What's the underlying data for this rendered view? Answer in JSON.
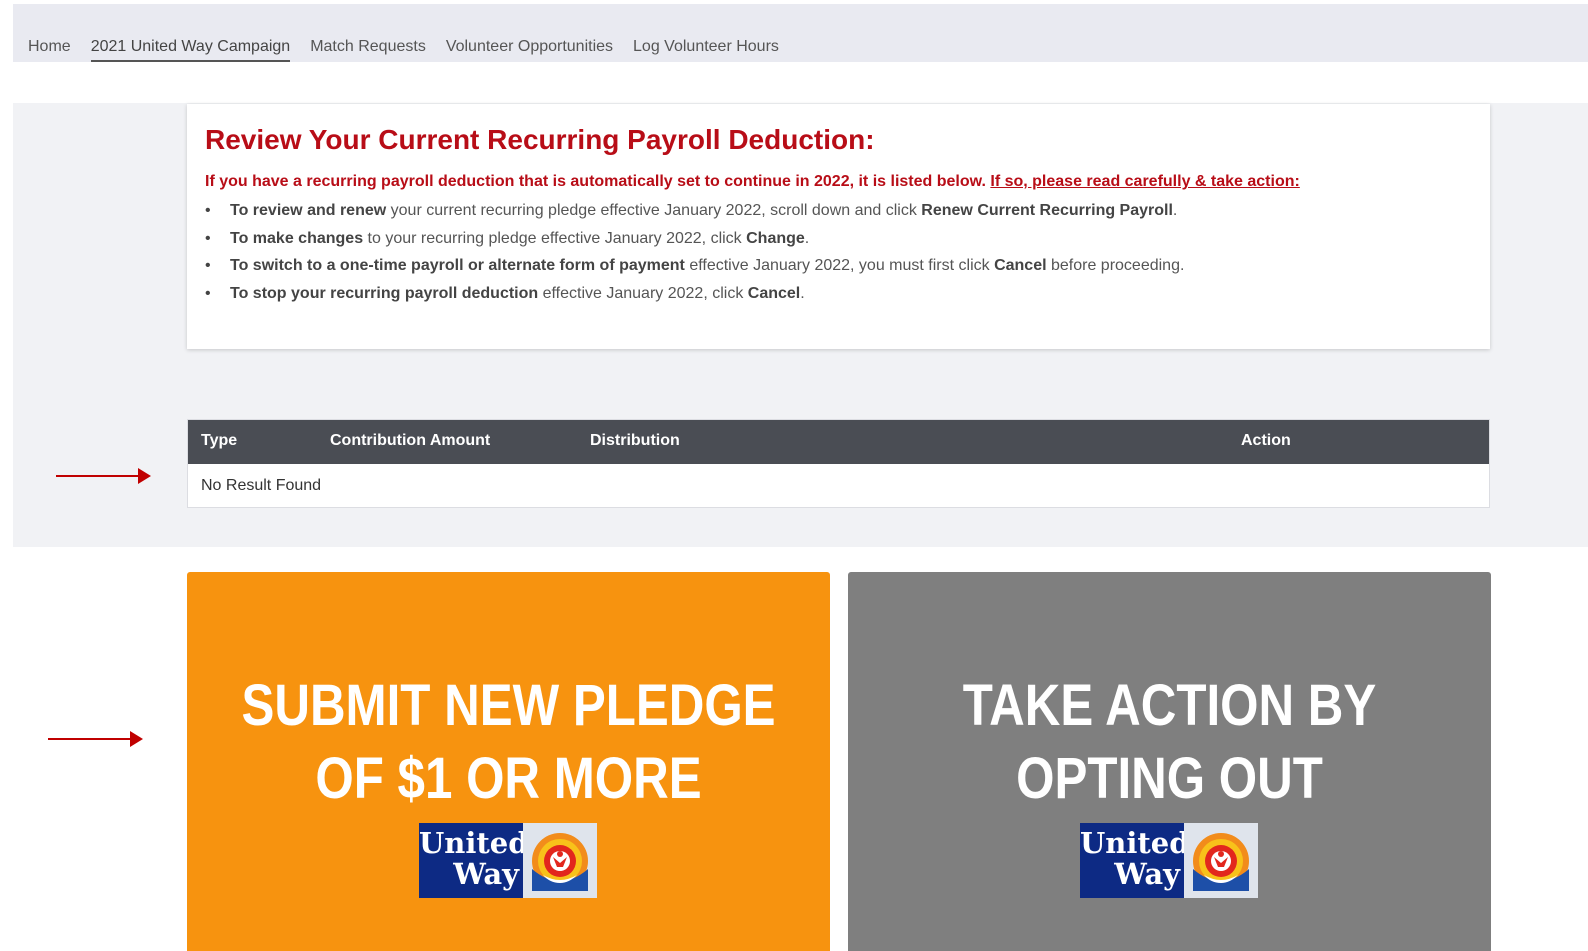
{
  "nav": {
    "items": [
      {
        "label": "Home"
      },
      {
        "label": "2021 United Way Campaign",
        "active": true
      },
      {
        "label": "Match Requests"
      },
      {
        "label": "Volunteer Opportunities"
      },
      {
        "label": "Log Volunteer Hours"
      }
    ]
  },
  "review": {
    "title": "Review Your Current Recurring Payroll Deduction:",
    "intro": "If you have a recurring payroll deduction that is automatically set to continue in 2022, it is listed below.",
    "intro_link": "If so, please read carefully & take action:",
    "bullets": [
      {
        "b1": "To review and renew",
        "t1": " your current recurring pledge effective January 2022, scroll down and click ",
        "b2": "Renew Current Recurring Payroll",
        "t2": "."
      },
      {
        "b1": "To make changes",
        "t1": " to your recurring pledge effective January 2022, click ",
        "b2": "Change",
        "t2": "."
      },
      {
        "b1": "To switch to a one-time payroll or alternate form of payment",
        "t1": " effective January 2022, you must first click ",
        "b2": "Cancel",
        "t2": " before proceeding."
      },
      {
        "b1": "To stop your recurring payroll deduction",
        "t1": " effective January 2022, click ",
        "b2": "Cancel",
        "t2": "."
      }
    ]
  },
  "table": {
    "columns": [
      "Type",
      "Contribution Amount",
      "Distribution",
      "Action"
    ],
    "empty_message": "No Result Found"
  },
  "tiles": {
    "submit": {
      "line1": "SUBMIT NEW PLEDGE",
      "line2": "OF $1 OR MORE",
      "logo_line1": "United",
      "logo_line2": "Way"
    },
    "optout": {
      "line1": "TAKE ACTION BY",
      "line2": "OPTING OUT",
      "logo_line1": "United",
      "logo_line2": "Way"
    }
  },
  "colors": {
    "accent_red": "#b80d17",
    "orange_tile": "#f7930f",
    "gray_tile": "#7f7f7f",
    "table_header": "#4a4d54",
    "united_way_blue": "#0d2a84"
  },
  "icons": [
    "arrow-right-icon",
    "united-way-logo"
  ]
}
